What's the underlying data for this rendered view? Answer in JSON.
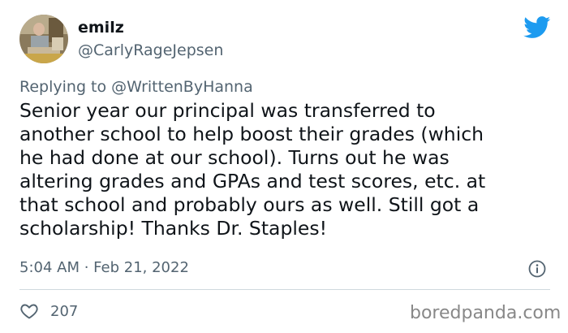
{
  "user": {
    "display_name": "emilz",
    "handle": "@CarlyRageJepsen"
  },
  "reply": {
    "prefix": "Replying to ",
    "mention": "@WrittenByHanna"
  },
  "tweet": {
    "text": "Senior year our principal was transferred to\nanother school to help boost their grades (which\nhe had done at our school). Turns out he was\naltering grades and GPAs and test scores, etc. at\nthat school and probably ours as well. Still got a\nscholarship! Thanks Dr. Staples!"
  },
  "meta": {
    "timestamp": "5:04 AM · Feb 21, 2022"
  },
  "actions": {
    "like_count": "207"
  },
  "watermark": "boredpanda.com",
  "icons": {
    "logo": "twitter-bird-icon",
    "info": "info-icon",
    "like": "heart-icon"
  },
  "colors": {
    "brand": "#1d9bf0",
    "text": "#0f1419",
    "secondary": "#536471",
    "divider": "#cfd9de"
  }
}
